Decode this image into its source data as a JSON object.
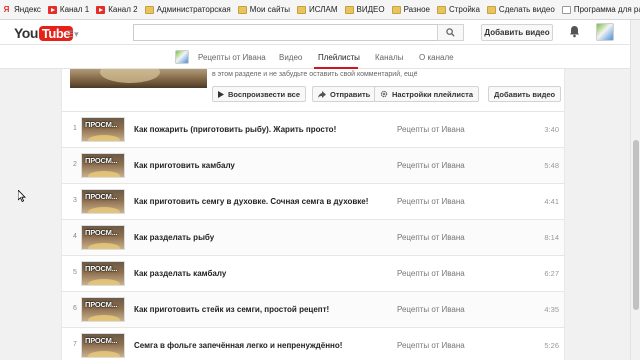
{
  "bookmarks": [
    {
      "label": "Яндекс",
      "icon": "yandex-icon"
    },
    {
      "label": "Канал 1",
      "icon": "youtube-icon"
    },
    {
      "label": "Канал 2",
      "icon": "youtube-icon"
    },
    {
      "label": "Администраторская",
      "icon": "folder-icon"
    },
    {
      "label": "Мои сайты",
      "icon": "folder-icon"
    },
    {
      "label": "ИСЛАМ",
      "icon": "folder-icon"
    },
    {
      "label": "ВИДЕО",
      "icon": "folder-icon"
    },
    {
      "label": "Разное",
      "icon": "folder-icon"
    },
    {
      "label": "Стройка",
      "icon": "folder-icon"
    },
    {
      "label": "Сделать видео",
      "icon": "folder-icon"
    },
    {
      "label": "Программа для расс...",
      "icon": "page-icon"
    }
  ],
  "header": {
    "logo_you": "You",
    "logo_tube": "Tube",
    "search_placeholder": "",
    "upload_label": "Добавить видео"
  },
  "channel_nav": {
    "tabs": [
      "Рецепты от Ивана",
      "Видео",
      "Плейлисты",
      "Каналы",
      "О канале"
    ],
    "active_tab": "Плейлисты"
  },
  "playlist": {
    "description": "в этом разделе и не забудьте оставить свой комментарий, ещё",
    "play_all_label": "Воспроизвести все",
    "share_label": "Отправить",
    "settings_label": "Настройки плейлиста",
    "add_video_label": "Добавить видео",
    "thumb_text": "ПРОСМ...",
    "items": [
      {
        "index": "1",
        "title": "Как пожарить (приготовить рыбу). Жарить просто!",
        "owner": "Рецепты от Ивана",
        "duration": "3:40"
      },
      {
        "index": "2",
        "title": "Как приготовить камбалу",
        "owner": "Рецепты от Ивана",
        "duration": "5:48"
      },
      {
        "index": "3",
        "title": "Как приготовить семгу в духовке. Сочная семга в духовке!",
        "owner": "Рецепты от Ивана",
        "duration": "4:41"
      },
      {
        "index": "4",
        "title": "Как разделать рыбу",
        "owner": "Рецепты от Ивана",
        "duration": "8:14"
      },
      {
        "index": "5",
        "title": "Как разделать камбалу",
        "owner": "Рецепты от Ивана",
        "duration": "6:27"
      },
      {
        "index": "6",
        "title": "Как приготовить стейк из семги, простой рецепт!",
        "owner": "Рецепты от Ивана",
        "duration": "4:35"
      },
      {
        "index": "7",
        "title": "Семга в фольге запечённая легко и непренуждённо!",
        "owner": "Рецепты от Ивана",
        "duration": "5:26"
      }
    ]
  },
  "colors": {
    "brand_red": "#e62117",
    "tab_underline": "#cc181e",
    "background": "#f1f1f1"
  }
}
